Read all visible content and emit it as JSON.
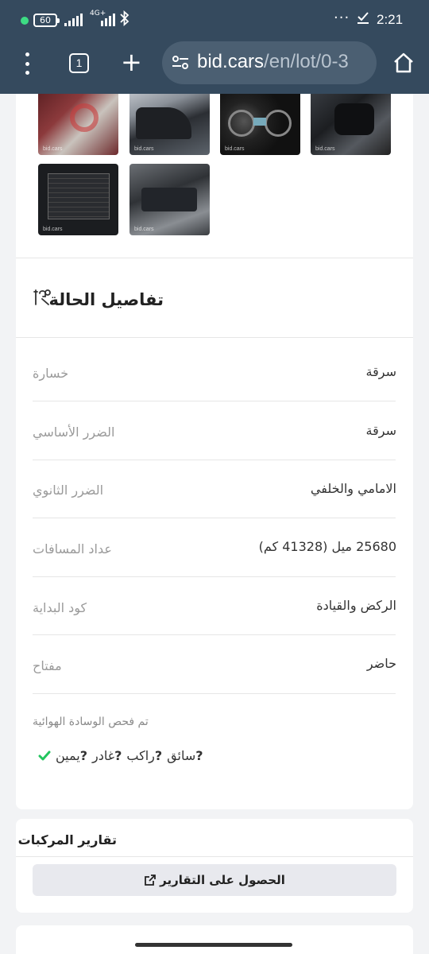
{
  "status_bar": {
    "battery": "60",
    "network": "4G+",
    "time": "2:21"
  },
  "browser": {
    "tab_count": "1",
    "url_host": "bid.cars",
    "url_path": "/en/lot/0-3",
    "icons": [
      "menu-icon",
      "tabs-icon",
      "new-tab-icon",
      "site-settings-icon",
      "home-icon"
    ]
  },
  "condition": {
    "title": "تفاصيل الحالة",
    "rows": [
      {
        "label": "خسارة",
        "value": "سرقة"
      },
      {
        "label": "الضرر الأساسي",
        "value": "سرقة"
      },
      {
        "label": "الضرر الثانوي",
        "value": "الامامي والخلفي"
      },
      {
        "label": "عداد المسافات",
        "value": "25680 ميل (41328 كم)"
      },
      {
        "label": "كود البداية",
        "value": "الركض والقيادة"
      },
      {
        "label": "مفتاح",
        "value": "حاضر"
      }
    ],
    "airbag": {
      "title": "تم فحص الوسادة الهوائية",
      "items": [
        {
          "label": "سائق",
          "status": "?"
        },
        {
          "label": "راكب",
          "status": "?"
        },
        {
          "label": "غادر",
          "status": "?"
        },
        {
          "label": "يمين",
          "status": "?"
        }
      ],
      "check_color": "#22c55e"
    }
  },
  "reports": {
    "title": "تقارير المركبات",
    "button_label": "الحصول على التقارير"
  },
  "gallery": {
    "watermark": "bid.cars"
  }
}
